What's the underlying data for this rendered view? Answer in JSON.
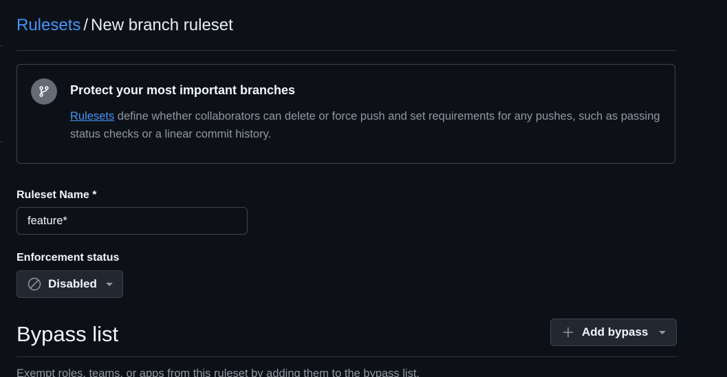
{
  "breadcrumb": {
    "parent": "Rulesets",
    "separator": "/",
    "current": "New branch ruleset"
  },
  "info_box": {
    "icon": "git-branch-icon",
    "title": "Protect your most important branches",
    "link_text": "Rulesets",
    "description": " define whether collaborators can delete or force push and set requirements for any pushes, such as passing status checks or a linear commit history."
  },
  "ruleset_name": {
    "label": "Ruleset Name *",
    "value": "feature*"
  },
  "enforcement": {
    "label": "Enforcement status",
    "icon": "circle-slash-icon",
    "selected": "Disabled"
  },
  "bypass": {
    "title": "Bypass list",
    "add_button": "Add bypass",
    "add_icon": "plus-icon",
    "description": "Exempt roles, teams, or apps from this ruleset by adding them to the bypass list."
  },
  "colors": {
    "background": "#0d1117",
    "accent_link": "#4493f8",
    "border": "#3d444d",
    "muted_text": "#9198a1"
  }
}
